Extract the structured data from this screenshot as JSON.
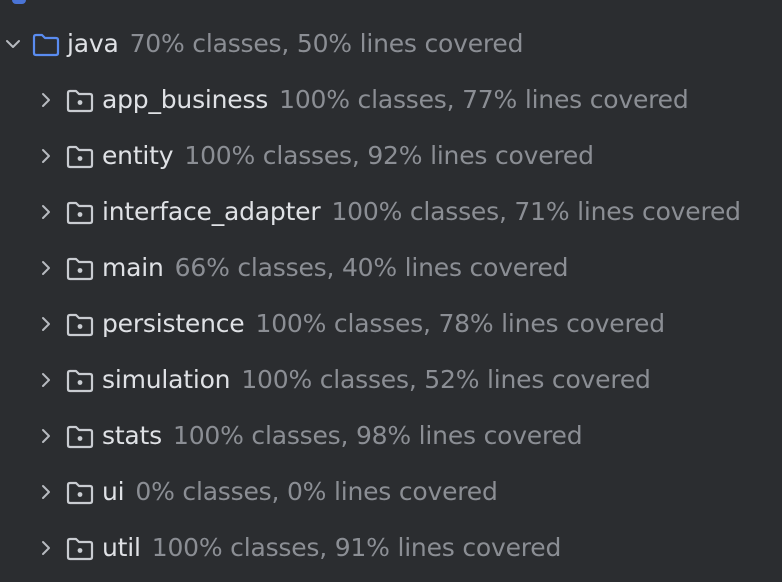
{
  "tree": {
    "root": {
      "name": "java",
      "stats": "70% classes, 50% lines covered",
      "expanded": true,
      "icon": "folder-blue-icon"
    },
    "children": [
      {
        "name": "app_business",
        "stats": "100% classes, 77% lines covered"
      },
      {
        "name": "entity",
        "stats": "100% classes, 92% lines covered"
      },
      {
        "name": "interface_adapter",
        "stats": "100% classes, 71% lines covered"
      },
      {
        "name": "main",
        "stats": "66% classes, 40% lines covered"
      },
      {
        "name": "persistence",
        "stats": "100% classes, 78% lines covered"
      },
      {
        "name": "simulation",
        "stats": "100% classes, 52% lines covered"
      },
      {
        "name": "stats",
        "stats": "100% classes, 98% lines covered"
      },
      {
        "name": "ui",
        "stats": "0% classes, 0% lines covered"
      },
      {
        "name": "util",
        "stats": "100% classes, 91% lines covered"
      }
    ]
  },
  "colors": {
    "background": "#2b2d30",
    "name_text": "#dfe1e5",
    "stats_text": "#8b8e94",
    "root_folder": "#5a8cf0",
    "package_folder": "#c9ccd1"
  }
}
